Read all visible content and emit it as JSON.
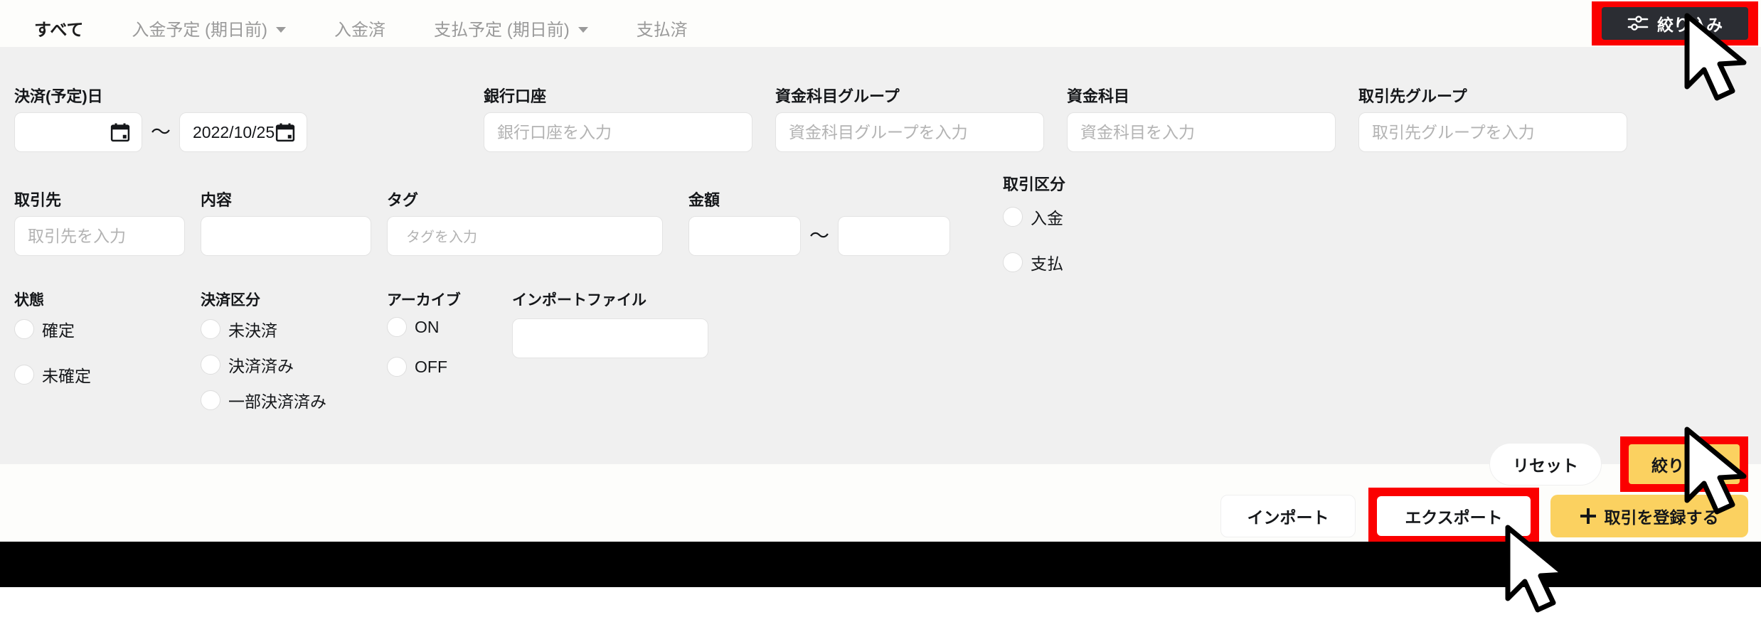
{
  "tabs": [
    {
      "label": "すべて",
      "active": true,
      "caret": false
    },
    {
      "label": "入金予定 (期日前)",
      "active": false,
      "caret": true
    },
    {
      "label": "入金済",
      "active": false,
      "caret": false
    },
    {
      "label": "支払予定 (期日前)",
      "active": false,
      "caret": true
    },
    {
      "label": "支払済",
      "active": false,
      "caret": false
    }
  ],
  "filter_button": {
    "label": "絞り込み",
    "icon": "sliders-icon",
    "highlight_color": "#fb0000",
    "background": "#2b2d33"
  },
  "panel": {
    "background": "#f0f0f0",
    "date": {
      "label": "決済(予定)日",
      "from_value": "",
      "from_placeholder": "",
      "separator": "～",
      "to_value": "2022/10/25",
      "to_placeholder": "",
      "icon": "calendar-icon"
    },
    "bank_account": {
      "label": "銀行口座",
      "value": "",
      "placeholder": "銀行口座を入力"
    },
    "fund_item_group": {
      "label": "資金科目グループ",
      "value": "",
      "placeholder": "資金科目グループを入力"
    },
    "fund_item": {
      "label": "資金科目",
      "value": "",
      "placeholder": "資金科目を入力"
    },
    "partner_group": {
      "label": "取引先グループ",
      "value": "",
      "placeholder": "取引先グループを入力"
    },
    "partner": {
      "label": "取引先",
      "value": "",
      "placeholder": "取引先を入力"
    },
    "content": {
      "label": "内容",
      "value": "",
      "placeholder": ""
    },
    "tag": {
      "label": "タグ",
      "value": "",
      "placeholder": "タグを入力"
    },
    "amount": {
      "label": "金額",
      "from_value": "",
      "from_placeholder": "",
      "separator": "～",
      "to_value": "",
      "to_placeholder": ""
    },
    "transaction_type": {
      "label": "取引区分",
      "options": [
        {
          "label": "入金",
          "selected": false
        },
        {
          "label": "支払",
          "selected": false
        }
      ]
    },
    "status": {
      "label": "状態",
      "options": [
        {
          "label": "確定",
          "selected": false
        },
        {
          "label": "未確定",
          "selected": false
        }
      ]
    },
    "settlement_type": {
      "label": "決済区分",
      "options": [
        {
          "label": "未決済",
          "selected": false
        },
        {
          "label": "決済済み",
          "selected": false
        },
        {
          "label": "一部決済済み",
          "selected": false
        }
      ]
    },
    "archive": {
      "label": "アーカイブ",
      "options": [
        {
          "label": "ON",
          "selected": false
        },
        {
          "label": "OFF",
          "selected": false
        }
      ]
    },
    "import_file": {
      "label": "インポートファイル",
      "value": "",
      "placeholder": ""
    },
    "reset_label": "リセット",
    "apply_label": "絞り込む",
    "apply_color": "#fbd160",
    "apply_highlight_color": "#fb0000"
  },
  "actions": {
    "import_label": "インポート",
    "export_label": "エクスポート",
    "export_highlight_color": "#fb0000",
    "register_label": "取引を登録する",
    "register_icon": "plus-icon",
    "register_color": "#fbd160"
  }
}
